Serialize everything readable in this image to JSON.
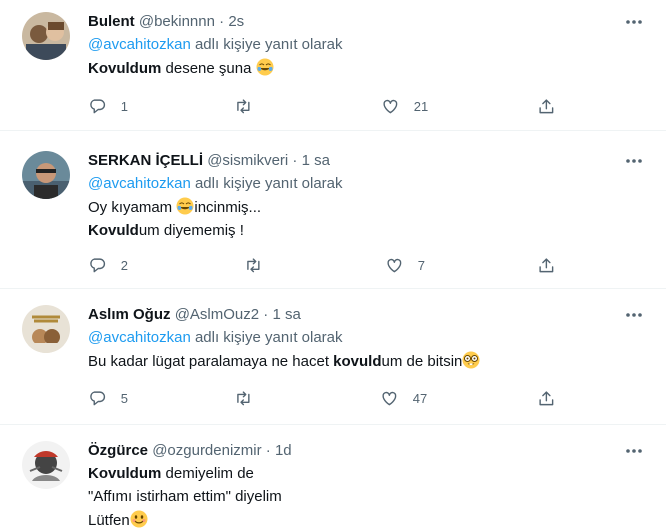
{
  "tweets": [
    {
      "name": "Bulent",
      "handle": "@bekinnnn",
      "separator": "·",
      "time": "2s",
      "reply_to": "@avcahitozkan",
      "reply_suffix": "adlı kişiye yanıt olarak",
      "lines": [
        {
          "bold": "Kovuldum",
          "text": " desene şuna",
          "emoji": "joy-emoji"
        }
      ],
      "counts": {
        "reply": "1",
        "retweet": "",
        "like": "21"
      }
    },
    {
      "name": "SERKAN İÇELLİ",
      "handle": "@sismikveri",
      "separator": "·",
      "time": "1 sa",
      "reply_to": "@avcahitozkan",
      "reply_suffix": "adlı kişiye yanıt olarak",
      "lines": [
        {
          "pre": "Oy kıyamam ",
          "emoji": "joy-emoji",
          "post": "incinmiş..."
        },
        {
          "bold": "Kovuld",
          "text": "um diyememiş !"
        }
      ],
      "counts": {
        "reply": "2",
        "retweet": "",
        "like": "7"
      }
    },
    {
      "name": "Aslım Oğuz",
      "handle": "@AslmOuz2",
      "separator": "·",
      "time": "1 sa",
      "reply_to": "@avcahitozkan",
      "reply_suffix": "adlı kişiye yanıt olarak",
      "lines": [
        {
          "pre": "Bu kadar lügat paralamaya ne hacet ",
          "bold": "kovuld",
          "text": "um de bitsin",
          "emoji": "nerd-emoji"
        }
      ],
      "counts": {
        "reply": "5",
        "retweet": "",
        "like": "47"
      }
    },
    {
      "name": "Özgürce",
      "handle": "@ozgurdenizmir",
      "separator": "·",
      "time": "1d",
      "lines": [
        {
          "bold": "Kovuldum",
          "text": " demiyelim de"
        },
        {
          "text": "\"Affımı istirham ettim\" diyelim"
        },
        {
          "text": "Lütfen",
          "emoji": "smile-emoji"
        }
      ]
    }
  ],
  "icons": {
    "more": "more-icon",
    "reply": "reply-icon",
    "retweet": "retweet-icon",
    "like": "heart-icon",
    "share": "share-icon"
  },
  "colors": {
    "link": "#1d9bf0",
    "muted": "#536471",
    "text": "#0f1419",
    "divider": "#eff3f4"
  }
}
